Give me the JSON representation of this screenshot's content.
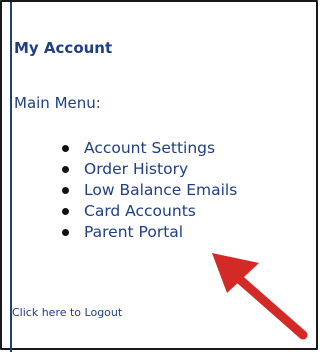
{
  "account": {
    "title": "My Account",
    "menu_label": "Main Menu:",
    "menu_items": [
      {
        "label": "Account Settings"
      },
      {
        "label": "Order History"
      },
      {
        "label": "Low Balance Emails"
      },
      {
        "label": "Card Accounts"
      },
      {
        "label": "Parent Portal"
      }
    ],
    "logout_label": "Click here to Logout"
  },
  "colors": {
    "link_blue": "#1f3f86",
    "arrow_red": "#d42a27"
  },
  "annotation": {
    "icon": "red-arrow-icon",
    "points_to": "Parent Portal"
  }
}
